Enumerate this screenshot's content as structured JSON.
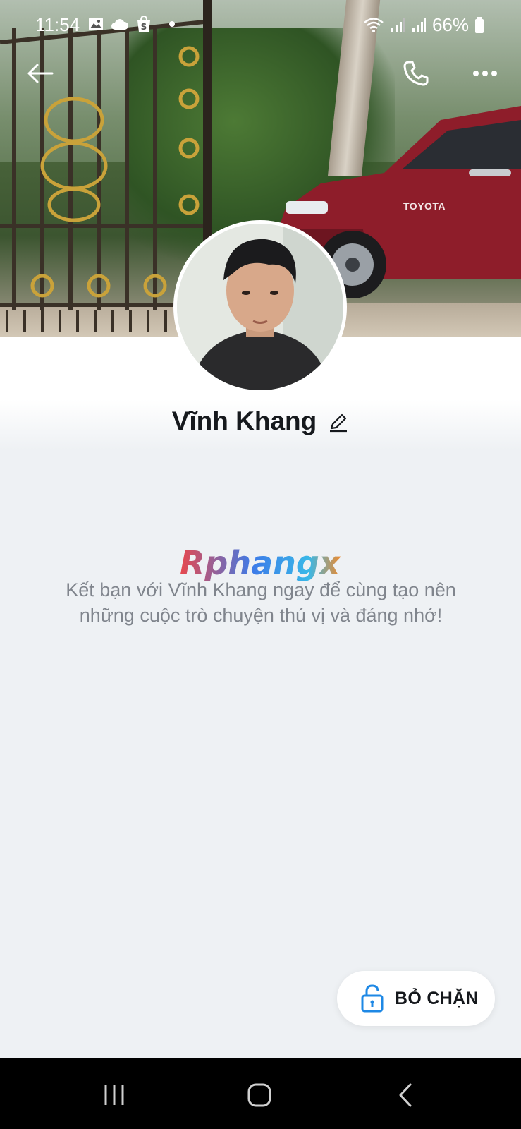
{
  "status_bar": {
    "time": "11:54",
    "battery": "66%",
    "left_icons": [
      "gallery-icon",
      "cloud-icon",
      "shopee-icon",
      "dot-icon"
    ],
    "right_icons": [
      "wifi-icon",
      "signal-icon",
      "signal-icon",
      "battery-icon"
    ]
  },
  "header": {
    "icons": [
      "back-arrow-icon",
      "phone-icon",
      "more-dots-icon"
    ]
  },
  "profile": {
    "name": "Vĩnh Khang",
    "edit_icon": "pencil-icon"
  },
  "cover": {
    "car_brand": "TOYOTA"
  },
  "watermark": {
    "text": "Rphangx"
  },
  "message": {
    "text": "Kết bạn với Vĩnh Khang ngay để cùng tạo nên những cuộc trò chuyện thú vị và đáng nhớ!"
  },
  "unblock": {
    "label": "BỎ CHẶN",
    "icon": "unlock-icon"
  },
  "nav_bar": {
    "icons": [
      "recents-icon",
      "home-icon",
      "nav-back-icon"
    ]
  },
  "colors": {
    "background": "#eef1f4",
    "message_text": "#80858d",
    "accent_blue": "#1e88e5"
  }
}
